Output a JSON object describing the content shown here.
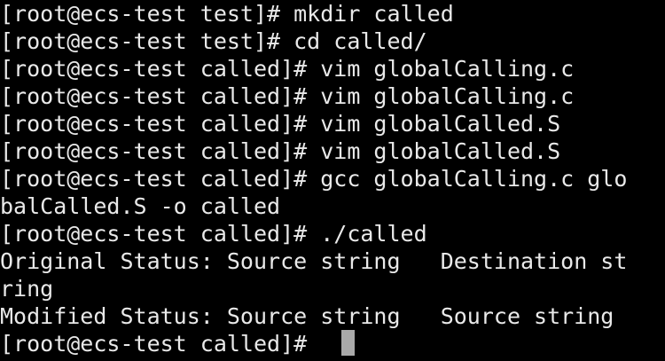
{
  "terminal": {
    "lines": [
      "[root@ecs-test test]# mkdir called",
      "[root@ecs-test test]# cd called/",
      "[root@ecs-test called]# vim globalCalling.c",
      "[root@ecs-test called]# vim globalCalling.c",
      "[root@ecs-test called]# vim globalCalled.S",
      "[root@ecs-test called]# vim globalCalled.S",
      "[root@ecs-test called]# gcc globalCalling.c glo",
      "balCalled.S -o called",
      "[root@ecs-test called]# ./called",
      "Original Status: Source string   Destination st",
      "ring",
      "Modified Status: Source string   Source string",
      "[root@ecs-test called]# "
    ],
    "colors": {
      "background": "#000000",
      "foreground": "#e9e9e9",
      "cursor": "#a9a9a9"
    }
  }
}
